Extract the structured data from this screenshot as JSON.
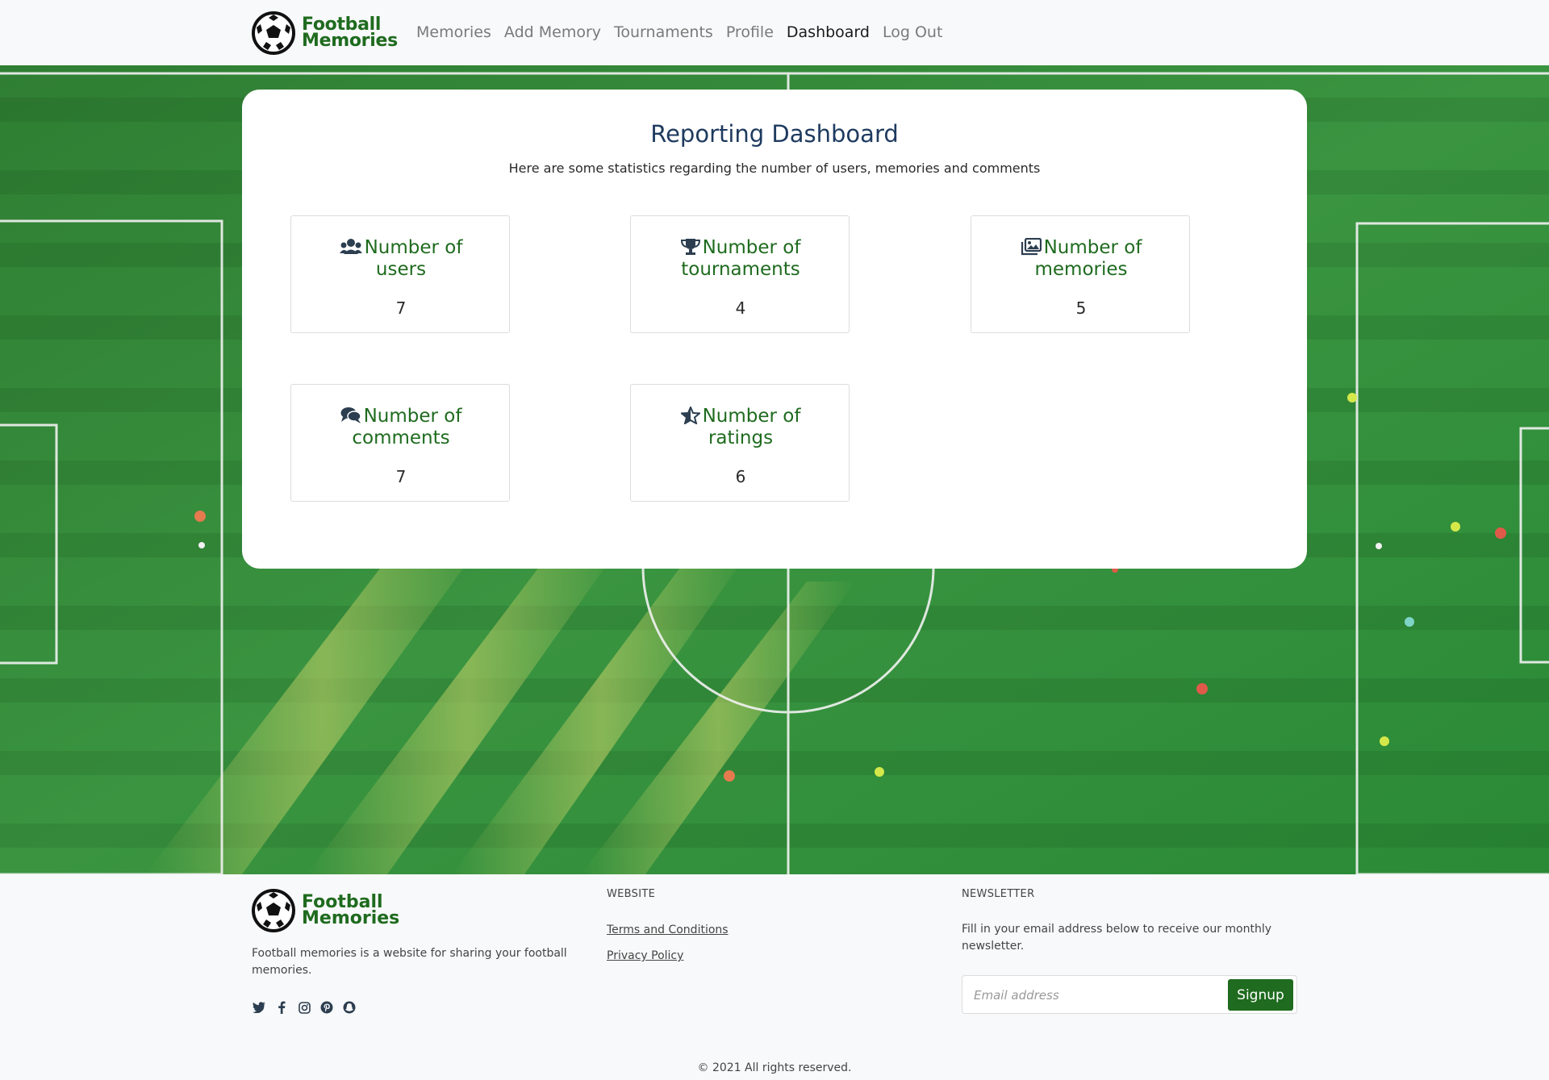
{
  "brand": {
    "line1": "Football",
    "line2": "Memories"
  },
  "nav": {
    "items": [
      {
        "label": "Memories"
      },
      {
        "label": "Add Memory"
      },
      {
        "label": "Tournaments"
      },
      {
        "label": "Profile"
      },
      {
        "label": "Dashboard",
        "active": true
      },
      {
        "label": "Log Out"
      }
    ]
  },
  "dashboard": {
    "title": "Reporting Dashboard",
    "subtitle": "Here are some statistics regarding the number of users, memories and comments",
    "stats": [
      {
        "icon": "users-icon",
        "line1": "Number of",
        "line2": "users",
        "value": "7"
      },
      {
        "icon": "trophy-icon",
        "line1": "Number of",
        "line2": "tournaments",
        "value": "4"
      },
      {
        "icon": "images-icon",
        "line1": "Number of",
        "line2": "memories",
        "value": "5"
      },
      {
        "icon": "comments-icon",
        "line1": "Number of",
        "line2": "comments",
        "value": "7"
      },
      {
        "icon": "star-half-icon",
        "line1": "Number of",
        "line2": "ratings",
        "value": "6"
      }
    ]
  },
  "footer": {
    "description": "Football memories is a website for sharing your football memories.",
    "socials": [
      "twitter-icon",
      "facebook-icon",
      "instagram-icon",
      "pinterest-icon",
      "snapchat-icon"
    ],
    "website_heading": "WEBSITE",
    "links": [
      {
        "label": "Terms and Conditions"
      },
      {
        "label": "Privacy Policy"
      }
    ],
    "newsletter_heading": "NEWSLETTER",
    "newsletter_text": "Fill in your email address below to receive our monthly newsletter.",
    "email_placeholder": "Email address",
    "signup_label": "Signup",
    "copyright": "© 2021 All rights reserved."
  },
  "colors": {
    "brand_green": "#1f6b1f",
    "title_navy": "#1e3a5f",
    "pitch_green": "#2e8b3a"
  }
}
